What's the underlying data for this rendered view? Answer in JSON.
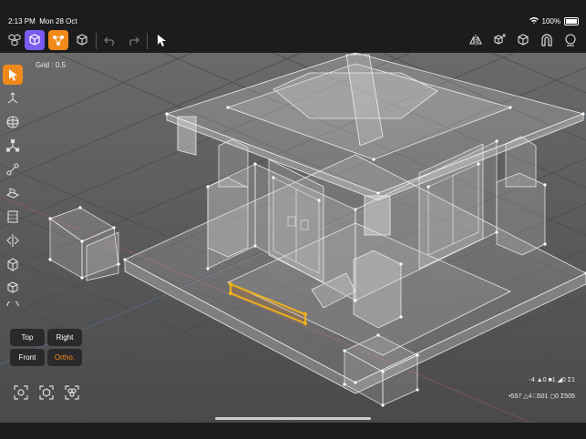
{
  "status": {
    "time": "2:13 PM",
    "date": "Mon 28 Oct",
    "battery": "100%"
  },
  "toolbar": {
    "left": [
      {
        "name": "objects-mode-button",
        "icon": "three-cubes-icon",
        "active": false
      },
      {
        "name": "object-mode-button",
        "icon": "cube-icon",
        "active": true,
        "color": "#7b5cf0"
      },
      {
        "name": "vertex-mode-button",
        "icon": "vertices-icon",
        "active": true,
        "color": "#f0891a"
      },
      {
        "name": "wireframe-button",
        "icon": "wire-cube-icon",
        "active": false
      },
      {
        "name": "undo-button",
        "icon": "undo-icon",
        "active": false
      },
      {
        "name": "redo-button",
        "icon": "redo-icon",
        "active": false
      },
      {
        "name": "select-cursor-button",
        "icon": "cursor-icon",
        "active": false
      }
    ],
    "right": [
      {
        "name": "mirror-button",
        "icon": "mirror-icon"
      },
      {
        "name": "add-primitive-button",
        "icon": "cube-plus-icon"
      },
      {
        "name": "view-cube-button",
        "icon": "cube-icon"
      },
      {
        "name": "magnet-snap-button",
        "icon": "magnet-icon"
      },
      {
        "name": "settings-button",
        "icon": "settings-icon"
      }
    ]
  },
  "viewport": {
    "grid_label": "Grid : 0.5"
  },
  "left_tools": [
    {
      "name": "select-tool",
      "icon": "cursor-icon",
      "active": true
    },
    {
      "name": "move-tool",
      "icon": "move-axes-icon",
      "active": false
    },
    {
      "name": "rotate-tool",
      "icon": "rotate-sphere-icon",
      "active": false
    },
    {
      "name": "scale-tool",
      "icon": "scale-axes-icon",
      "active": false
    },
    {
      "name": "edge-tool",
      "icon": "edge-icon",
      "active": false
    },
    {
      "name": "extrude-tool",
      "icon": "extrude-icon",
      "active": false
    },
    {
      "name": "loop-cut-tool",
      "icon": "loop-cut-icon",
      "active": false
    },
    {
      "name": "mirror-tool",
      "icon": "mirror-tool-icon",
      "active": false
    },
    {
      "name": "bevel-tool",
      "icon": "bevel-icon",
      "active": false
    },
    {
      "name": "cube-tool",
      "icon": "cube-icon",
      "active": false
    },
    {
      "name": "more-tool",
      "icon": "more-icon",
      "active": false
    }
  ],
  "view_buttons": {
    "top": "Top",
    "right": "Right",
    "front": "Front",
    "ortho": "Ortho."
  },
  "focus_buttons": [
    "focus-selection-icon",
    "focus-object-icon",
    "focus-all-icon"
  ],
  "stats": {
    "line1": "-4 ▲0 ■1 ◢0 Σ1",
    "line2": "•557 △4 □501 ◻0 Σ505"
  },
  "colors": {
    "accent": "#f0891a",
    "purple": "#7b5cf0",
    "bar": "#1c1c1e",
    "viewport": "#5a5a5a"
  }
}
